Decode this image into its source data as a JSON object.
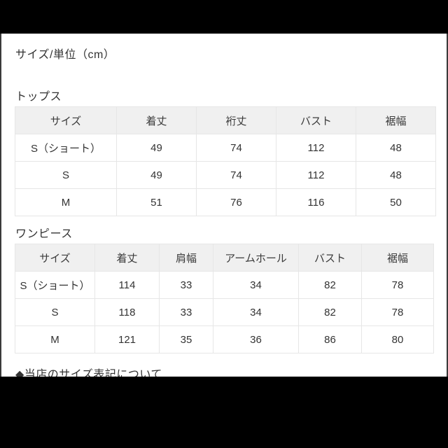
{
  "page": {
    "title": "サイズ/単位（cm）",
    "footer_note": "◆当店のサイズ表記について",
    "background_color": "#ffffff",
    "letterbox_color": "#000000",
    "text_color": "#333333",
    "header_fill": "#f0f0f0",
    "border_color": "#e6e6e6"
  },
  "tables": [
    {
      "section_label": "トップス",
      "headers": [
        "サイズ",
        "着丈",
        "裄丈",
        "バスト",
        "裾幅"
      ],
      "rows": [
        [
          "S（ショート）",
          "49",
          "74",
          "112",
          "48"
        ],
        [
          "S",
          "49",
          "74",
          "112",
          "48"
        ],
        [
          "M",
          "51",
          "76",
          "116",
          "50"
        ]
      ]
    },
    {
      "section_label": "ワンピース",
      "headers": [
        "サイズ",
        "着丈",
        "肩幅",
        "アームホール",
        "バスト",
        "裾幅"
      ],
      "rows": [
        [
          "S（ショート）",
          "114",
          "33",
          "34",
          "82",
          "78"
        ],
        [
          "S",
          "118",
          "33",
          "34",
          "82",
          "78"
        ],
        [
          "M",
          "121",
          "35",
          "36",
          "86",
          "80"
        ]
      ]
    }
  ]
}
